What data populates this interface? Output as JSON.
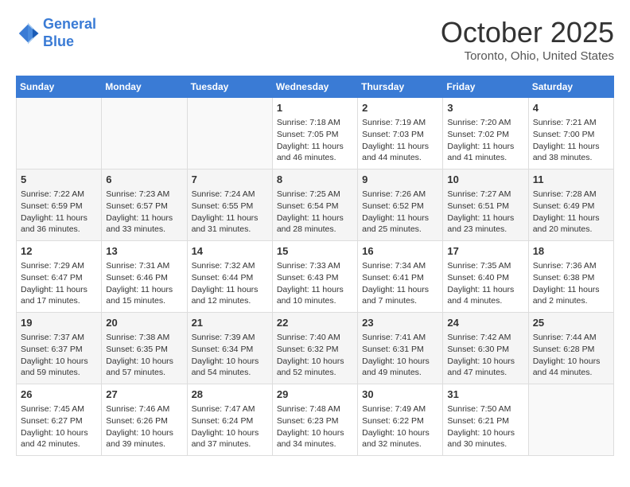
{
  "header": {
    "logo_line1": "General",
    "logo_line2": "Blue",
    "month_title": "October 2025",
    "subtitle": "Toronto, Ohio, United States"
  },
  "days_of_week": [
    "Sunday",
    "Monday",
    "Tuesday",
    "Wednesday",
    "Thursday",
    "Friday",
    "Saturday"
  ],
  "weeks": [
    [
      {
        "day": "",
        "info": ""
      },
      {
        "day": "",
        "info": ""
      },
      {
        "day": "",
        "info": ""
      },
      {
        "day": "1",
        "info": "Sunrise: 7:18 AM\nSunset: 7:05 PM\nDaylight: 11 hours and 46 minutes."
      },
      {
        "day": "2",
        "info": "Sunrise: 7:19 AM\nSunset: 7:03 PM\nDaylight: 11 hours and 44 minutes."
      },
      {
        "day": "3",
        "info": "Sunrise: 7:20 AM\nSunset: 7:02 PM\nDaylight: 11 hours and 41 minutes."
      },
      {
        "day": "4",
        "info": "Sunrise: 7:21 AM\nSunset: 7:00 PM\nDaylight: 11 hours and 38 minutes."
      }
    ],
    [
      {
        "day": "5",
        "info": "Sunrise: 7:22 AM\nSunset: 6:59 PM\nDaylight: 11 hours and 36 minutes."
      },
      {
        "day": "6",
        "info": "Sunrise: 7:23 AM\nSunset: 6:57 PM\nDaylight: 11 hours and 33 minutes."
      },
      {
        "day": "7",
        "info": "Sunrise: 7:24 AM\nSunset: 6:55 PM\nDaylight: 11 hours and 31 minutes."
      },
      {
        "day": "8",
        "info": "Sunrise: 7:25 AM\nSunset: 6:54 PM\nDaylight: 11 hours and 28 minutes."
      },
      {
        "day": "9",
        "info": "Sunrise: 7:26 AM\nSunset: 6:52 PM\nDaylight: 11 hours and 25 minutes."
      },
      {
        "day": "10",
        "info": "Sunrise: 7:27 AM\nSunset: 6:51 PM\nDaylight: 11 hours and 23 minutes."
      },
      {
        "day": "11",
        "info": "Sunrise: 7:28 AM\nSunset: 6:49 PM\nDaylight: 11 hours and 20 minutes."
      }
    ],
    [
      {
        "day": "12",
        "info": "Sunrise: 7:29 AM\nSunset: 6:47 PM\nDaylight: 11 hours and 17 minutes."
      },
      {
        "day": "13",
        "info": "Sunrise: 7:31 AM\nSunset: 6:46 PM\nDaylight: 11 hours and 15 minutes."
      },
      {
        "day": "14",
        "info": "Sunrise: 7:32 AM\nSunset: 6:44 PM\nDaylight: 11 hours and 12 minutes."
      },
      {
        "day": "15",
        "info": "Sunrise: 7:33 AM\nSunset: 6:43 PM\nDaylight: 11 hours and 10 minutes."
      },
      {
        "day": "16",
        "info": "Sunrise: 7:34 AM\nSunset: 6:41 PM\nDaylight: 11 hours and 7 minutes."
      },
      {
        "day": "17",
        "info": "Sunrise: 7:35 AM\nSunset: 6:40 PM\nDaylight: 11 hours and 4 minutes."
      },
      {
        "day": "18",
        "info": "Sunrise: 7:36 AM\nSunset: 6:38 PM\nDaylight: 11 hours and 2 minutes."
      }
    ],
    [
      {
        "day": "19",
        "info": "Sunrise: 7:37 AM\nSunset: 6:37 PM\nDaylight: 10 hours and 59 minutes."
      },
      {
        "day": "20",
        "info": "Sunrise: 7:38 AM\nSunset: 6:35 PM\nDaylight: 10 hours and 57 minutes."
      },
      {
        "day": "21",
        "info": "Sunrise: 7:39 AM\nSunset: 6:34 PM\nDaylight: 10 hours and 54 minutes."
      },
      {
        "day": "22",
        "info": "Sunrise: 7:40 AM\nSunset: 6:32 PM\nDaylight: 10 hours and 52 minutes."
      },
      {
        "day": "23",
        "info": "Sunrise: 7:41 AM\nSunset: 6:31 PM\nDaylight: 10 hours and 49 minutes."
      },
      {
        "day": "24",
        "info": "Sunrise: 7:42 AM\nSunset: 6:30 PM\nDaylight: 10 hours and 47 minutes."
      },
      {
        "day": "25",
        "info": "Sunrise: 7:44 AM\nSunset: 6:28 PM\nDaylight: 10 hours and 44 minutes."
      }
    ],
    [
      {
        "day": "26",
        "info": "Sunrise: 7:45 AM\nSunset: 6:27 PM\nDaylight: 10 hours and 42 minutes."
      },
      {
        "day": "27",
        "info": "Sunrise: 7:46 AM\nSunset: 6:26 PM\nDaylight: 10 hours and 39 minutes."
      },
      {
        "day": "28",
        "info": "Sunrise: 7:47 AM\nSunset: 6:24 PM\nDaylight: 10 hours and 37 minutes."
      },
      {
        "day": "29",
        "info": "Sunrise: 7:48 AM\nSunset: 6:23 PM\nDaylight: 10 hours and 34 minutes."
      },
      {
        "day": "30",
        "info": "Sunrise: 7:49 AM\nSunset: 6:22 PM\nDaylight: 10 hours and 32 minutes."
      },
      {
        "day": "31",
        "info": "Sunrise: 7:50 AM\nSunset: 6:21 PM\nDaylight: 10 hours and 30 minutes."
      },
      {
        "day": "",
        "info": ""
      }
    ]
  ]
}
